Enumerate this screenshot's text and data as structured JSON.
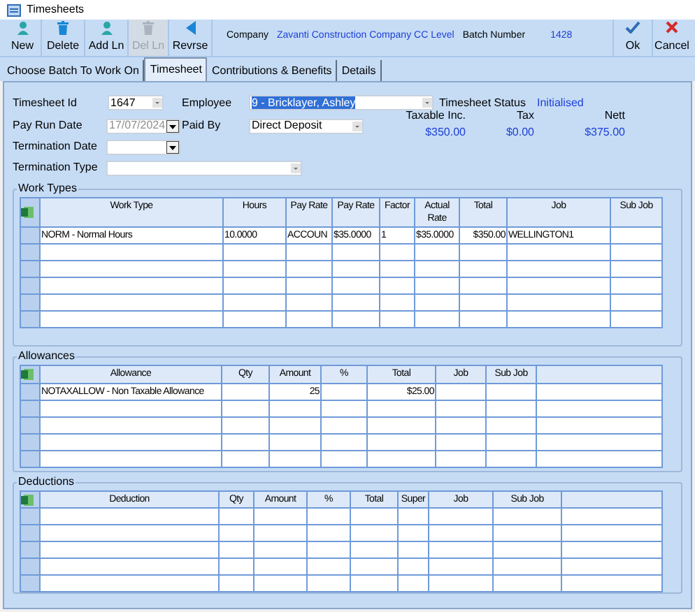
{
  "window": {
    "title": "Timesheets"
  },
  "toolbar": [
    {
      "label": "New",
      "disabled": false
    },
    {
      "label": "Delete",
      "disabled": false
    },
    {
      "label": "Add Ln",
      "disabled": false
    },
    {
      "label": "Del Ln",
      "disabled": true
    },
    {
      "label": "Revrse",
      "disabled": false
    }
  ],
  "header": {
    "company_label": "Company",
    "company": "Zavanti Construction Company CC Level",
    "batch_label": "Batch Number",
    "batch": "1428"
  },
  "actions": [
    {
      "label": "Ok"
    },
    {
      "label": "Cancel"
    }
  ],
  "tabs": [
    {
      "label": "Choose Batch To Work On",
      "selected": false
    },
    {
      "label": "Timesheet",
      "selected": true
    },
    {
      "label": "Contributions & Benefits",
      "selected": false
    },
    {
      "label": "Details",
      "selected": false
    }
  ],
  "form": {
    "timesheet_id": {
      "label": "Timesheet Id",
      "value": "1647",
      "disabled": false
    },
    "employee": {
      "label": "Employee",
      "value": "9 - Bricklayer, Ashley",
      "text_selected": true
    },
    "status": {
      "label": "Timesheet Status",
      "value": "Initialised"
    },
    "pay_run_date": {
      "label": "Pay Run Date",
      "value": "17/07/2024",
      "disabled": true
    },
    "paid_by": {
      "label": "Paid By",
      "value": "Direct Deposit"
    },
    "termination_date": {
      "label": "Termination Date"
    },
    "termination_type": {
      "label": "Termination Type"
    },
    "totals": [
      {
        "label": "Taxable Inc.",
        "value": "$350.00"
      },
      {
        "label": "Tax",
        "value": "$0.00"
      },
      {
        "label": "Nett",
        "value": "$375.00"
      }
    ]
  },
  "work_types": {
    "title": "Work Types",
    "columns": [
      "Work Type",
      "Hours",
      "Pay Rate",
      "Pay Rate",
      "Factor",
      "Actual Rate",
      "Total",
      "Job",
      "Sub Job"
    ],
    "rows": [
      [
        "NORM - Normal Hours",
        "10.0000",
        "ACCOUN",
        "$35.0000",
        "1",
        "$35.0000",
        "$350.00",
        "WELLINGTON1",
        ""
      ]
    ]
  },
  "allowances": {
    "title": "Allowances",
    "columns": [
      "Allowance",
      "Qty",
      "Amount",
      "%",
      "Total",
      "Job",
      "Sub Job",
      ""
    ],
    "rows": [
      [
        "NOTAXALLOW - Non Taxable Allowance",
        "",
        "25",
        "",
        "$25.00",
        "",
        "",
        ""
      ]
    ]
  },
  "deductions": {
    "title": "Deductions",
    "columns": [
      "Deduction",
      "Qty",
      "Amount",
      "%",
      "Total",
      "Super",
      "Job",
      "Sub Job",
      ""
    ]
  }
}
